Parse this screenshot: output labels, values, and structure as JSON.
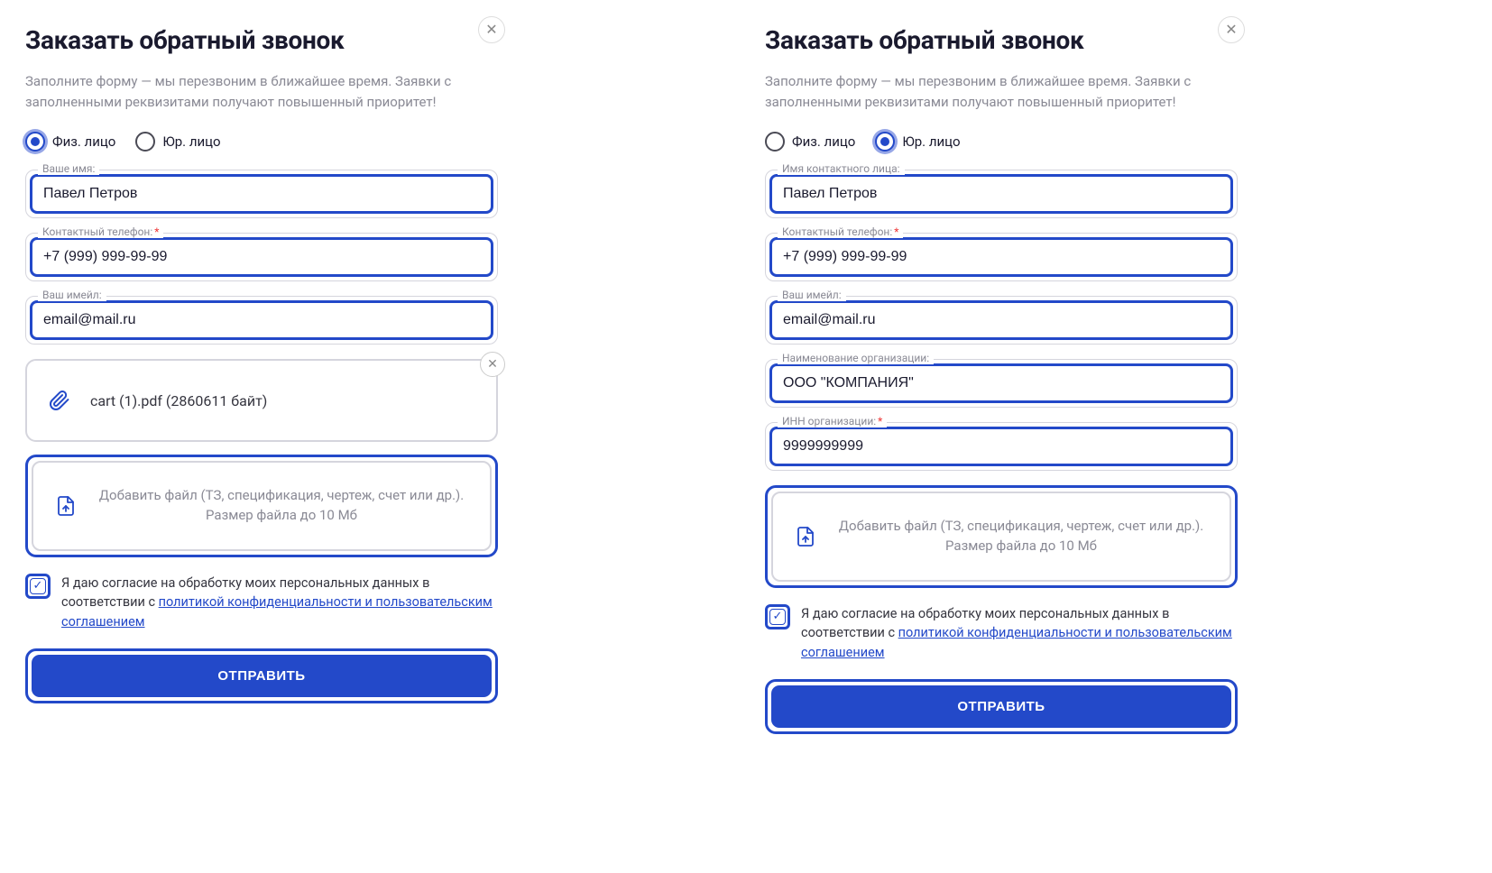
{
  "leftForm": {
    "title": "Заказать обратный звонок",
    "subtitle": "Заполните форму — мы перезвоним в ближайшее время. Заявки с заполненными реквизитами получают повышенный приоритет!",
    "radios": {
      "individual": "Физ. лицо",
      "company": "Юр. лицо",
      "selected": "individual"
    },
    "nameField": {
      "label": "Ваше имя:",
      "value": "Павел Петров"
    },
    "phoneField": {
      "label": "Контактный телефон:",
      "value": "+7 (999) 999-99-99"
    },
    "emailField": {
      "label": "Ваш имейл:",
      "value": "email@mail.ru"
    },
    "attachedFile": "cart (1).pdf (2860611 байт)",
    "uploadText": "Добавить файл (ТЗ, спецификация, чертеж, счет или др.). Размер файла до 10 Мб",
    "consentPrefix": "Я даю согласие на обработку моих персональных данных в соответствии с ",
    "consentLink": "политикой конфиденциальности и пользовательским соглашением",
    "submit": "ОТПРАВИТЬ"
  },
  "rightForm": {
    "title": "Заказать обратный звонок",
    "subtitle": "Заполните форму — мы перезвоним в ближайшее время. Заявки с заполненными реквизитами получают повышенный приоритет!",
    "radios": {
      "individual": "Физ. лицо",
      "company": "Юр. лицо",
      "selected": "company"
    },
    "nameField": {
      "label": "Имя контактного лица:",
      "value": "Павел Петров"
    },
    "phoneField": {
      "label": "Контактный телефон:",
      "value": "+7 (999) 999-99-99"
    },
    "emailField": {
      "label": "Ваш имейл:",
      "value": "email@mail.ru"
    },
    "orgField": {
      "label": "Наименование организации:",
      "value": "ООО \"КОМПАНИЯ\""
    },
    "innField": {
      "label": "ИНН организации:",
      "value": "9999999999"
    },
    "uploadText": "Добавить файл (ТЗ, спецификация, чертеж, счет или др.). Размер файла до 10 Мб",
    "consentPrefix": "Я даю согласие на обработку моих персональных данных в соответствии с ",
    "consentLink": "политикой конфиденциальности и пользовательским соглашением",
    "submit": "ОТПРАВИТЬ"
  }
}
